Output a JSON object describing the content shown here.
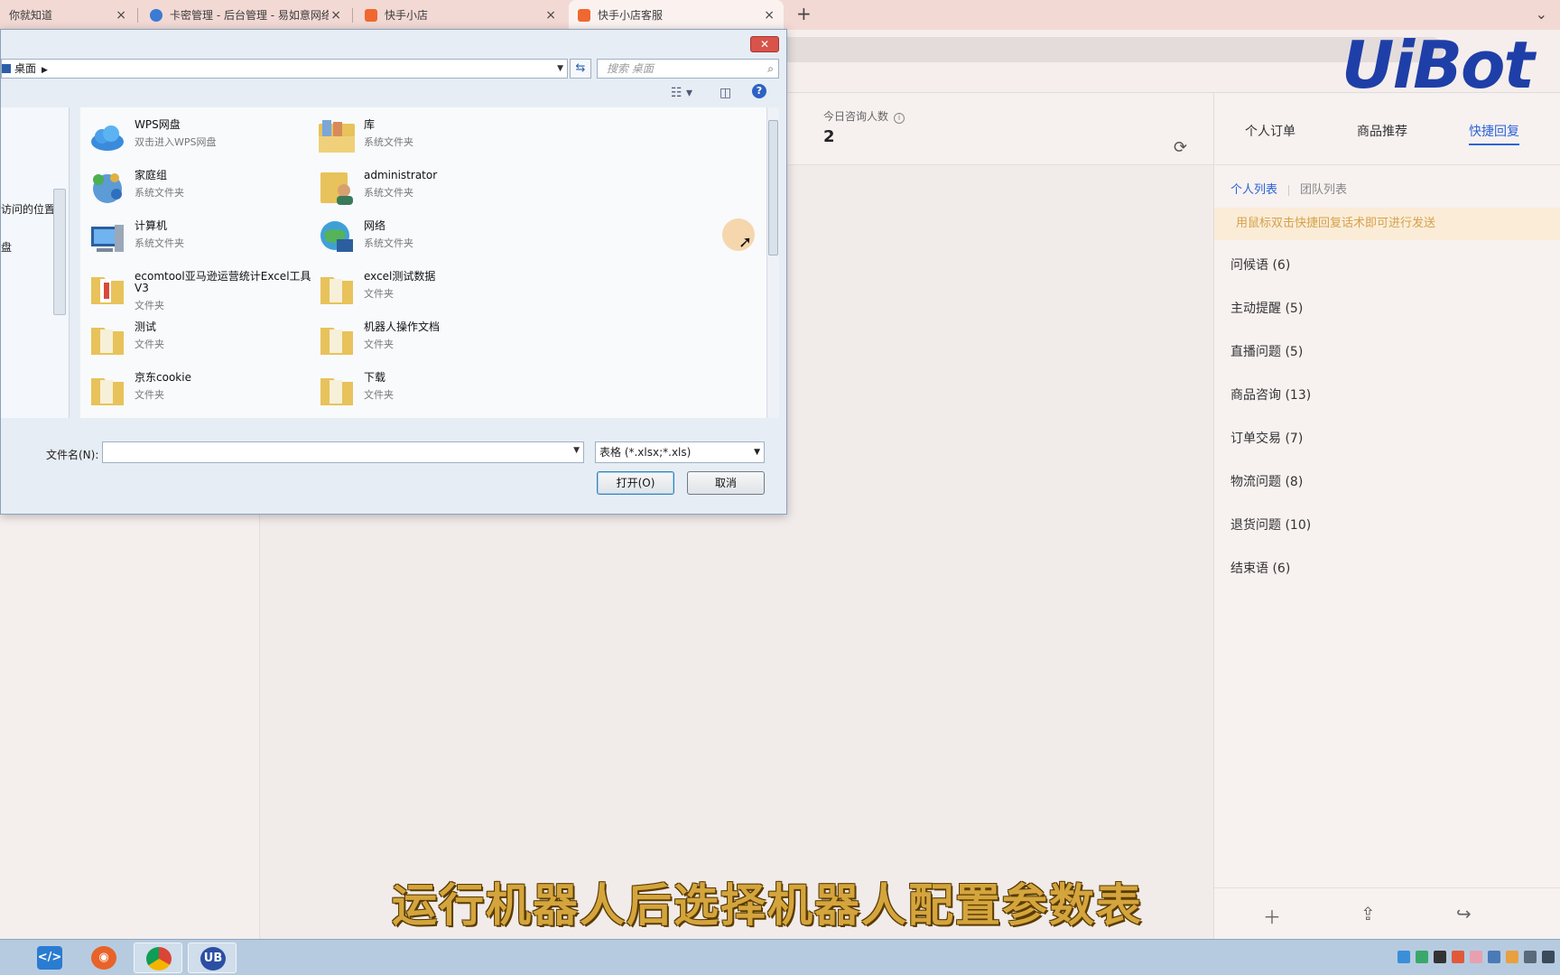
{
  "browser": {
    "tabs": [
      {
        "label": "你就知道",
        "color": "#e8e0de"
      },
      {
        "label": "卡密管理 - 后台管理 - 易如意网络",
        "color": "#3b7bd4"
      },
      {
        "label": "快手小店",
        "color": "#f06830"
      },
      {
        "label": "快手小店客服",
        "color": "#f06830"
      }
    ],
    "new_tab": "+",
    "close_glyph": "×",
    "overflow": "⌄"
  },
  "logo": "UiBot",
  "stats": {
    "label": "今日咨询人数",
    "info_glyph": "i",
    "value": "2"
  },
  "right_panel": {
    "tabs": [
      "个人订单",
      "商品推荐",
      "快捷回复"
    ],
    "active_tab": "快捷回复",
    "subtabs": [
      "个人列表",
      "团队列表"
    ],
    "hint": "用鼠标双击快捷回复话术即可进行发送",
    "items": [
      "问候语 (6)",
      "主动提醒 (5)",
      "直播问题 (5)",
      "商品咨询 (13)",
      "订单交易 (7)",
      "物流问题 (8)",
      "退货问题 (10)",
      "结束语 (6)"
    ]
  },
  "dialog": {
    "close_glyph": "✕",
    "breadcrumb": "桌面",
    "search_placeholder": "搜索 桌面",
    "nav_items": [
      "访问的位置",
      "盘"
    ],
    "files": [
      {
        "name": "WPS网盘",
        "type": "双击进入WPS网盘",
        "icon": "cloud-icon"
      },
      {
        "name": "库",
        "type": "系统文件夹",
        "icon": "library-icon"
      },
      {
        "name": "家庭组",
        "type": "系统文件夹",
        "icon": "homegroup-icon"
      },
      {
        "name": "administrator",
        "type": "系统文件夹",
        "icon": "user-folder-icon"
      },
      {
        "name": "计算机",
        "type": "系统文件夹",
        "icon": "computer-icon"
      },
      {
        "name": "网络",
        "type": "系统文件夹",
        "icon": "network-icon"
      },
      {
        "name": "ecomtool亚马逊运营统计Excel工具V3",
        "type": "文件夹",
        "icon": "folder-icon"
      },
      {
        "name": "excel测试数据",
        "type": "文件夹",
        "icon": "folder-icon"
      },
      {
        "name": "测试",
        "type": "文件夹",
        "icon": "folder-icon"
      },
      {
        "name": "机器人操作文档",
        "type": "文件夹",
        "icon": "folder-icon"
      },
      {
        "name": "京东cookie",
        "type": "文件夹",
        "icon": "folder-icon"
      },
      {
        "name": "下载",
        "type": "文件夹",
        "icon": "folder-icon"
      }
    ],
    "filename_label": "文件名(N):",
    "filename_value": "",
    "filter_value": "表格 (*.xlsx;*.xls)",
    "open_button": "打开(O)",
    "cancel_button": "取消"
  },
  "caption": "运行机器人后选择机器人配置参数表",
  "taskbar": {
    "apps": [
      {
        "name": "vscode",
        "color": "#2a7cd0"
      },
      {
        "name": "firefox",
        "color": "#e8632a"
      },
      {
        "name": "chrome",
        "color": "#3c9a4a"
      },
      {
        "name": "uibot",
        "color": "#2b4fa3",
        "label": "UB"
      }
    ]
  },
  "colors": {
    "accent": "#2b63d9",
    "hint_text": "#d4a24a",
    "caption": "#d4a53d"
  }
}
